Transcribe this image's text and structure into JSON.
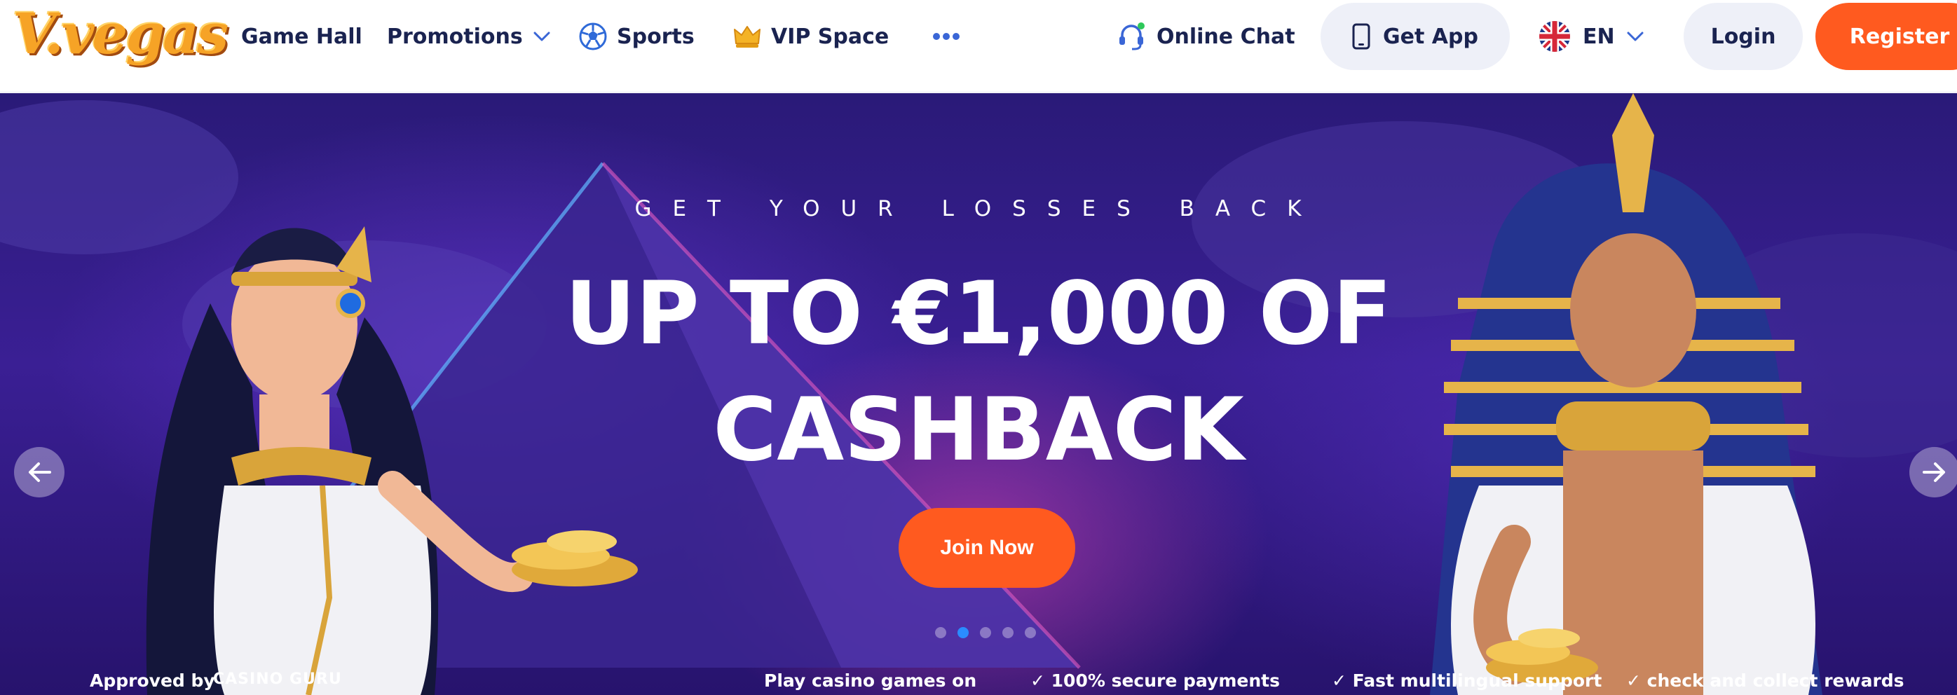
{
  "brand": {
    "logo_text": "V.vegas"
  },
  "nav": {
    "game_hall": "Game Hall",
    "promotions": "Promotions",
    "sports": "Sports",
    "vip": "VIP Space",
    "more_icon": "more-dots-icon",
    "online_chat": "Online Chat"
  },
  "actions": {
    "get_app": "Get App",
    "language": "EN",
    "login": "Login",
    "register": "Register"
  },
  "hero": {
    "kicker": "GET YOUR LOSSES BACK",
    "title_line1": "UP TO €1,000 OF",
    "title_line2": "CASHBACK",
    "cta": "Join Now",
    "slides_total": 5,
    "active_slide": 2
  },
  "trust_bar": {
    "approved": "Approved by",
    "guru": "CASINO GURU",
    "play": "Play casino games on",
    "secure": "✓ 100% secure payments",
    "fast": "✓ Fast multilingual support",
    "check": "✓ check and collect rewards"
  },
  "colors": {
    "accent": "#ff5a1f",
    "nav_text": "#1a2350",
    "pill_bg": "#eef0f8",
    "dot_active": "#2a8cff"
  }
}
